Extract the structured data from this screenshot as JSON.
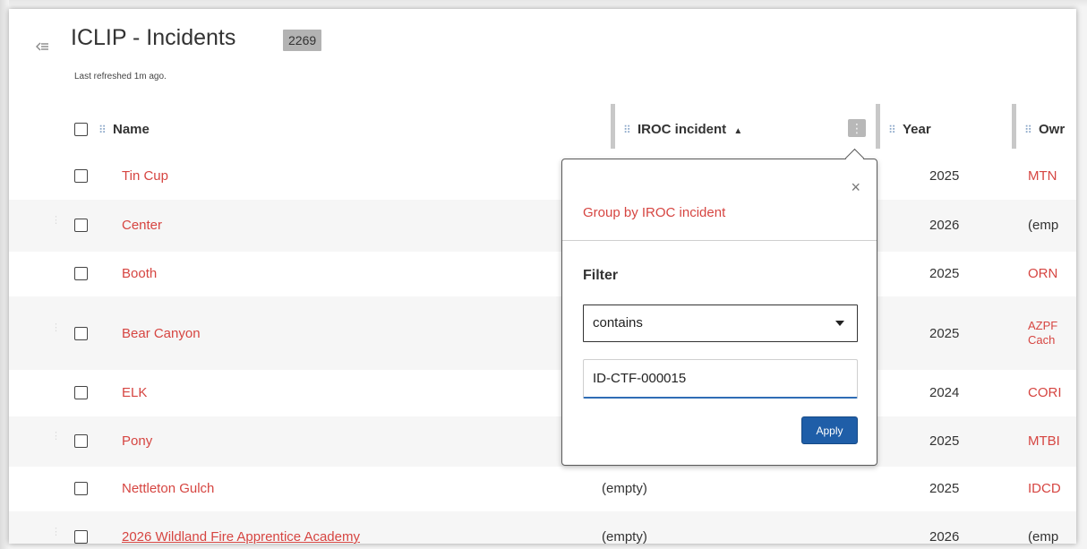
{
  "header": {
    "title": "ICLIP - Incidents",
    "count": "2269",
    "last_refreshed": "Last refreshed 1m ago."
  },
  "columns": {
    "name": "Name",
    "iroc_incident": "IROC incident",
    "year": "Year",
    "owner": "Owr"
  },
  "rows": [
    {
      "name": "Tin Cup",
      "iroc": "",
      "year": "2025",
      "owner": "MTN"
    },
    {
      "name": "Center",
      "iroc": "",
      "year": "2026",
      "owner": "(emp"
    },
    {
      "name": "Booth",
      "iroc": "",
      "year": "2025",
      "owner": "ORN"
    },
    {
      "name": "Bear Canyon",
      "iroc": "",
      "year": "2025",
      "owner": "AZPF",
      "owner_line2": "Cach"
    },
    {
      "name": "ELK",
      "iroc": "",
      "year": "2024",
      "owner": "CORI"
    },
    {
      "name": "Pony",
      "iroc": "",
      "year": "2025",
      "owner": "MTBI"
    },
    {
      "name": "Nettleton Gulch",
      "iroc": "(empty)",
      "year": "2025",
      "owner": "IDCD"
    },
    {
      "name": "2026 Wildland Fire Apprentice Academy",
      "iroc": "(empty)",
      "year": "2026",
      "owner": "(emp"
    }
  ],
  "popover": {
    "group_by_label": "Group by IROC incident",
    "filter_label": "Filter",
    "operator_value": "contains",
    "filter_value": "ID-CTF-000015",
    "apply_label": "Apply",
    "close_label": "×"
  },
  "colors": {
    "link_red": "#d64541",
    "primary_blue": "#1f5ea8",
    "grip_blue": "#8aa6c8"
  }
}
